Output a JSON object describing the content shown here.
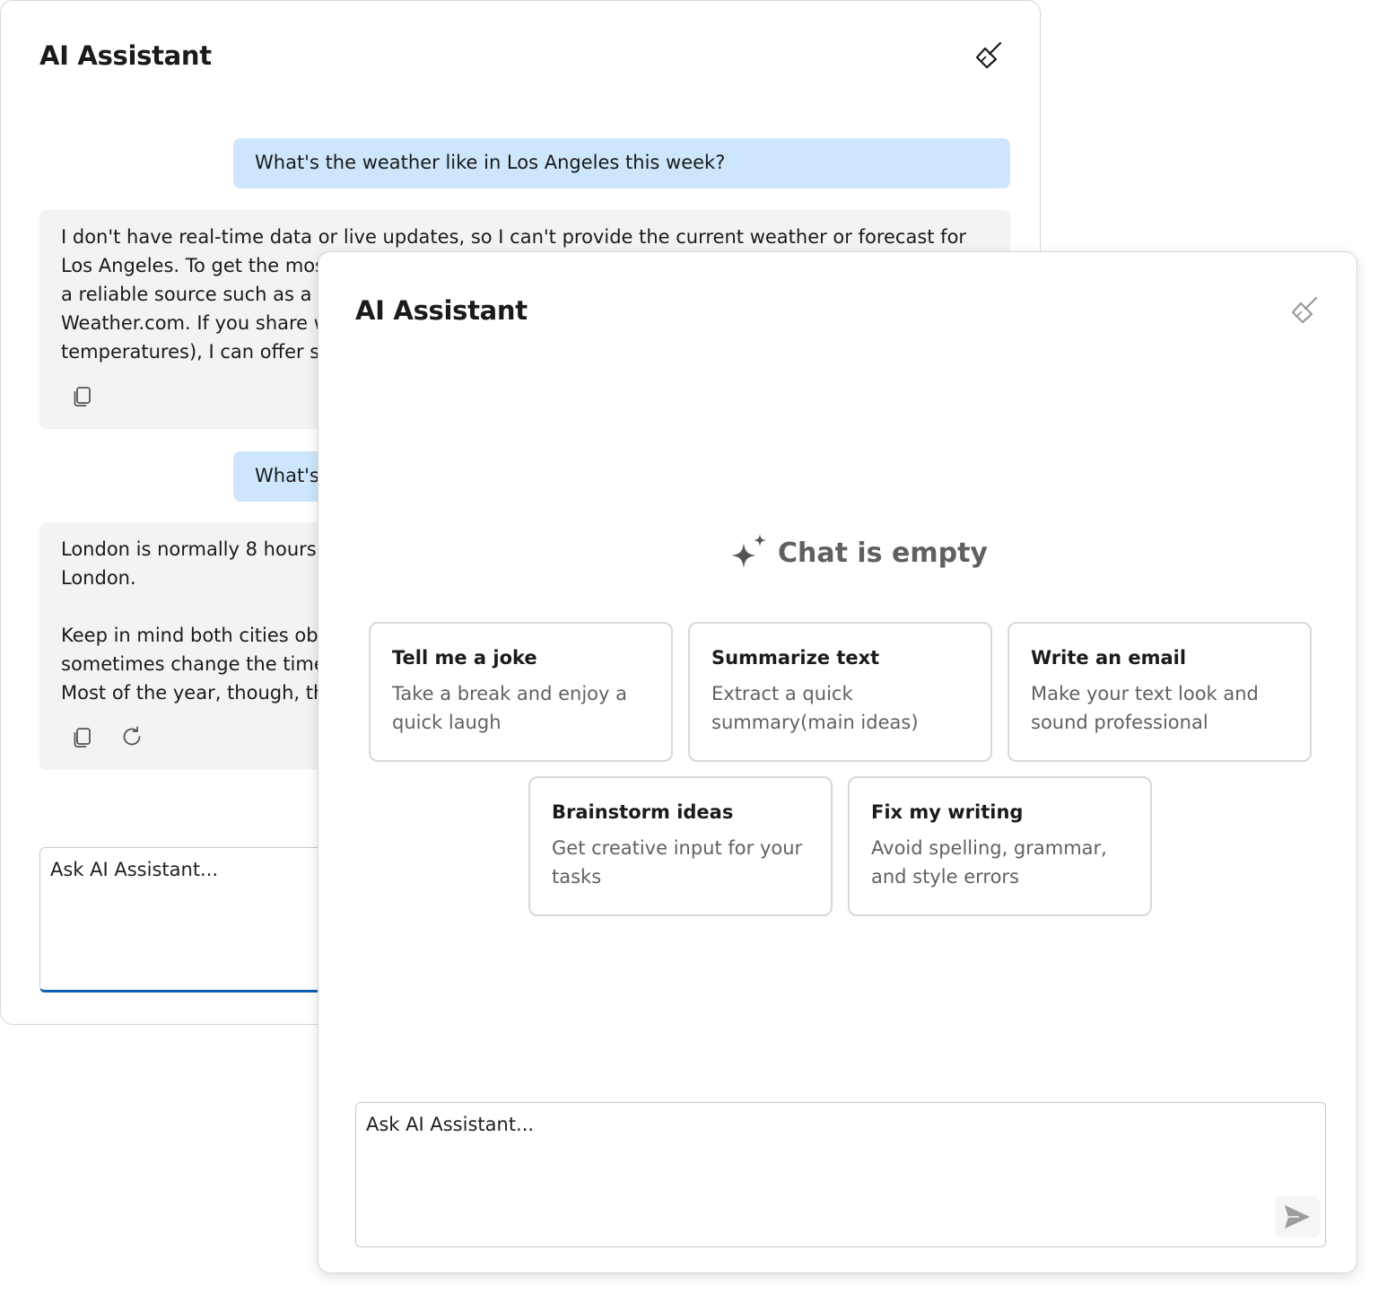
{
  "back_window": {
    "title": "AI Assistant",
    "messages": [
      {
        "role": "user",
        "text": "What's the weather like in Los Angeles this week?"
      },
      {
        "role": "assistant",
        "text": "I don't have real-time data or live updates, so I can't provide the current weather or forecast for\nLos Angeles. To get the mos\na reliable source such as a w\nWeather.com. If you share w\ntemperatures), I can offer so"
      },
      {
        "role": "user",
        "text": "What's"
      },
      {
        "role": "assistant",
        "text": "London is normally 8 hours\nLondon.\n\nKeep in mind both cities ob\nsometimes change the time\nMost of the year, though, th"
      }
    ],
    "input_placeholder": "Ask AI Assistant..."
  },
  "front_window": {
    "title": "AI Assistant",
    "empty_state": "Chat is empty",
    "suggestions": [
      {
        "title": "Tell me a joke",
        "description": "Take a break and enjoy a quick laugh"
      },
      {
        "title": "Summarize text",
        "description": "Extract a quick summary(main ideas)"
      },
      {
        "title": "Write an email",
        "description": "Make your text look and sound professional"
      },
      {
        "title": "Brainstorm ideas",
        "description": "Get creative input for your tasks"
      },
      {
        "title": "Fix my writing",
        "description": "Avoid spelling, grammar, and style errors"
      }
    ],
    "input_placeholder": "Ask AI Assistant..."
  },
  "icons": {
    "clear": "broom-icon",
    "copy": "copy-icon",
    "regenerate": "refresh-icon",
    "sparkle": "sparkle-icon",
    "send": "send-icon"
  },
  "colors": {
    "user_bubble": "#cde6fb",
    "assistant_bubble": "#f3f3f3",
    "focus_underline": "#0f5fb5"
  }
}
